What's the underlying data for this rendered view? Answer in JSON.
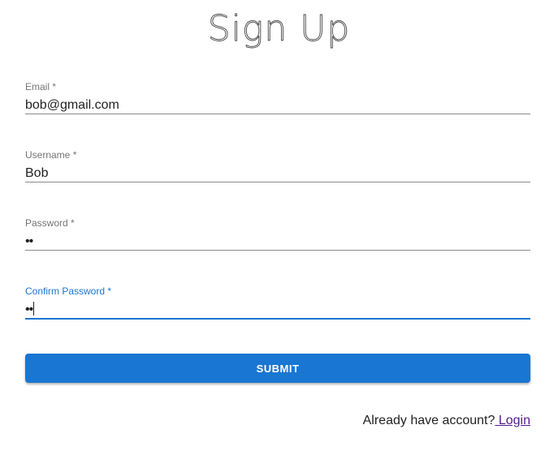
{
  "page_title": "Sign Up",
  "form": {
    "email": {
      "label": "Email *",
      "value": "bob@gmail.com"
    },
    "username": {
      "label": "Username *",
      "value": "Bob"
    },
    "password": {
      "label": "Password *",
      "value": "••"
    },
    "confirm_password": {
      "label": "Confirm Password *",
      "value": "••"
    },
    "submit_label": "SUBMIT"
  },
  "footer": {
    "prompt": "Already have account?",
    "login_link": " Login"
  },
  "colors": {
    "primary": "#1976d2",
    "label": "#757575",
    "link_visited": "#551a8b"
  }
}
